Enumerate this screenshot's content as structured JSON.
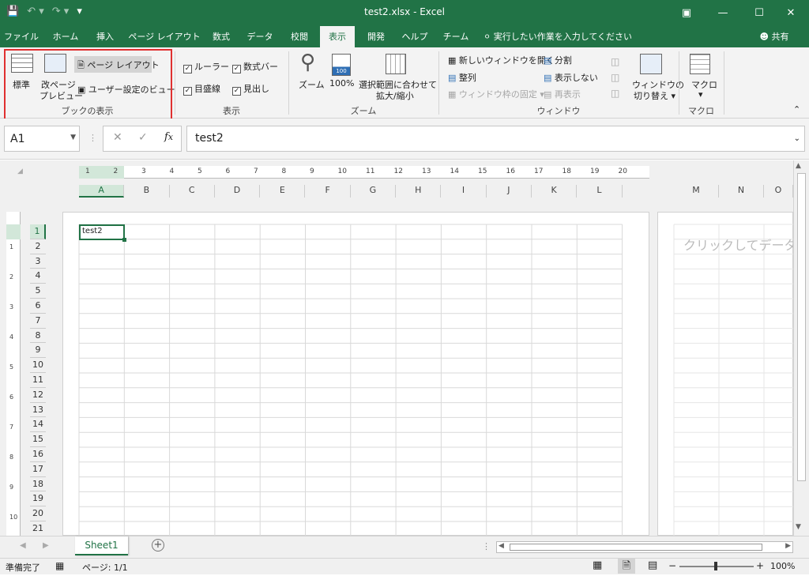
{
  "window": {
    "title": "test2.xlsx - Excel"
  },
  "tabs": [
    "ファイル",
    "ホーム",
    "挿入",
    "ページ レイアウト",
    "数式",
    "データ",
    "校閲",
    "表示",
    "開発",
    "ヘルプ",
    "チーム"
  ],
  "active_tab": "表示",
  "tell_me": "実行したい作業を入力してください",
  "share": "共有",
  "ribbon": {
    "workbook_views": {
      "label": "ブックの表示",
      "normal": "標準",
      "page_break_1": "改ページ",
      "page_break_2": "プレビュー",
      "page_layout": "ページ レイアウト",
      "custom_views": "ユーザー設定のビュー"
    },
    "show": {
      "label": "表示",
      "ruler": "ルーラー",
      "formula_bar": "数式バー",
      "gridlines": "目盛線",
      "headings": "見出し"
    },
    "zoom": {
      "label": "ズーム",
      "zoom": "ズーム",
      "hundred": "100%",
      "zoom_sel_1": "選択範囲に合わせて",
      "zoom_sel_2": "拡大/縮小",
      "icon_text": "100"
    },
    "window": {
      "label": "ウィンドウ",
      "new_window": "新しいウィンドウを開く",
      "arrange": "整列",
      "freeze": "ウィンドウ枠の固定",
      "split": "分割",
      "hide": "表示しない",
      "unhide": "再表示",
      "switch_1": "ウィンドウの",
      "switch_2": "切り替え"
    },
    "macro": {
      "label": "マクロ",
      "macro": "マクロ"
    }
  },
  "name_box": "A1",
  "formula_value": "test2",
  "ruler_numbers": [
    "1",
    "2",
    "3",
    "4",
    "5",
    "6",
    "7",
    "8",
    "9",
    "10",
    "11",
    "12",
    "13",
    "14",
    "15",
    "16",
    "17",
    "18",
    "19",
    "20"
  ],
  "columns": [
    "A",
    "B",
    "C",
    "D",
    "E",
    "F",
    "G",
    "H",
    "I",
    "J",
    "K",
    "L"
  ],
  "columns_right": [
    "M",
    "N",
    "O"
  ],
  "rows": [
    "1",
    "2",
    "3",
    "4",
    "5",
    "6",
    "7",
    "8",
    "9",
    "10",
    "11",
    "12",
    "13",
    "14",
    "15",
    "16",
    "17",
    "18",
    "19",
    "20",
    "21"
  ],
  "left_ruler": [
    "1",
    "2",
    "3",
    "4",
    "5",
    "6",
    "7",
    "8",
    "9",
    "10"
  ],
  "cell_a1": "test2",
  "next_page_hint": "クリックしてデータを",
  "sheet": {
    "name": "Sheet1"
  },
  "status": {
    "ready": "準備完了",
    "page": "ページ: 1/1",
    "zoom": "100%"
  },
  "colors": {
    "accent": "#217346",
    "highlight": "#e03030"
  }
}
